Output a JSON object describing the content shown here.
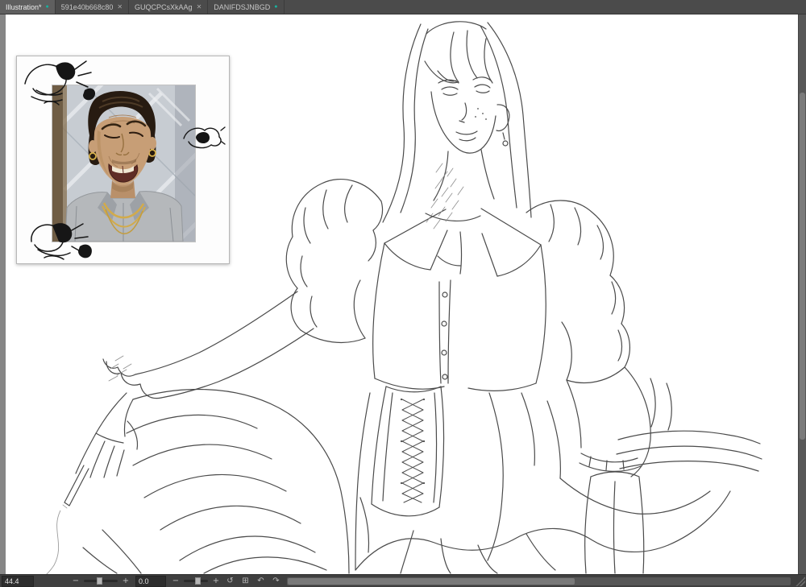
{
  "colors": {
    "accent_teal": "#17b3a0",
    "chrome_gray": "#4b4b4b",
    "statusbar_gray": "#3f3f3f",
    "canvas_white": "#ffffff"
  },
  "tabbar": {
    "tabs": [
      {
        "label": "Illustration*",
        "indicator": "unsaved-dot",
        "active": true
      },
      {
        "label": "591e40b668c80",
        "indicator": "close",
        "active": false
      },
      {
        "label": "GUQCPCsXkAAg",
        "indicator": "close",
        "active": false
      },
      {
        "label": "DANIFDSJNBGD",
        "indicator": "unsaved-dot",
        "active": false
      }
    ]
  },
  "icons": {
    "close": "✕",
    "unsaved_dot": "●",
    "zoom_out": "−",
    "zoom_in": "+",
    "rotate_ccw": "−",
    "rotate_cw": "+",
    "rotate_reset": "↺",
    "fit_screen": "⊞",
    "undo": "↶",
    "redo": "↷"
  },
  "statusbar": {
    "zoom_value": "44.4",
    "rotation_value": "0.0"
  }
}
